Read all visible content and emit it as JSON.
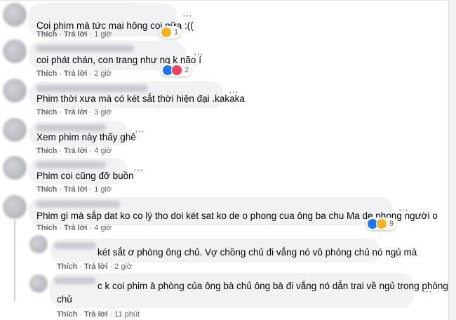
{
  "labels": {
    "like": "Thích",
    "reply": "Trả lời",
    "separator": "·"
  },
  "more_icon": "⋯",
  "comments": [
    {
      "text": "Coi phim mà tức mai hông coi nữa :((",
      "time": "1 giờ",
      "reactions": [
        "sad-reaction-icon"
      ],
      "reaction_count": "1"
    },
    {
      "text": "coi phát chán, con trang như ng k não í",
      "time": "2 giờ",
      "reactions": [
        "like-reaction-icon",
        "love-reaction-icon"
      ],
      "reaction_count": "2"
    },
    {
      "text": "Phim thời xưa mà có két sắt thời hiện đại .kakaka",
      "time": "3 giờ"
    },
    {
      "text": "Xem phim này thấy ghê",
      "time": "4 giờ"
    },
    {
      "text": "Phim coi cũng đỡ buồn",
      "time": "1 giờ"
    },
    {
      "text": "Phim gi mà sắp dat ko co lý tho doi két sat ko de o phong cua ông ba chu Ma de phong người o",
      "time": "4 giờ",
      "reactions": [
        "like-reaction-icon",
        "haha-reaction-icon"
      ],
      "reaction_count": "9"
    }
  ],
  "replies": [
    {
      "text": "két sắt ơ phòng ông chủ. Vợ chồng chủ đi vắng nó vô phòng chủ nó ngủ mà",
      "time": "2 giờ"
    },
    {
      "text_line1": "c k coi phim à phòng của ông bà chủ ông bà đi vắng nó dẫn trai về ngủ trong phòng",
      "text_line2": "chủ",
      "time": "11 phút"
    }
  ]
}
